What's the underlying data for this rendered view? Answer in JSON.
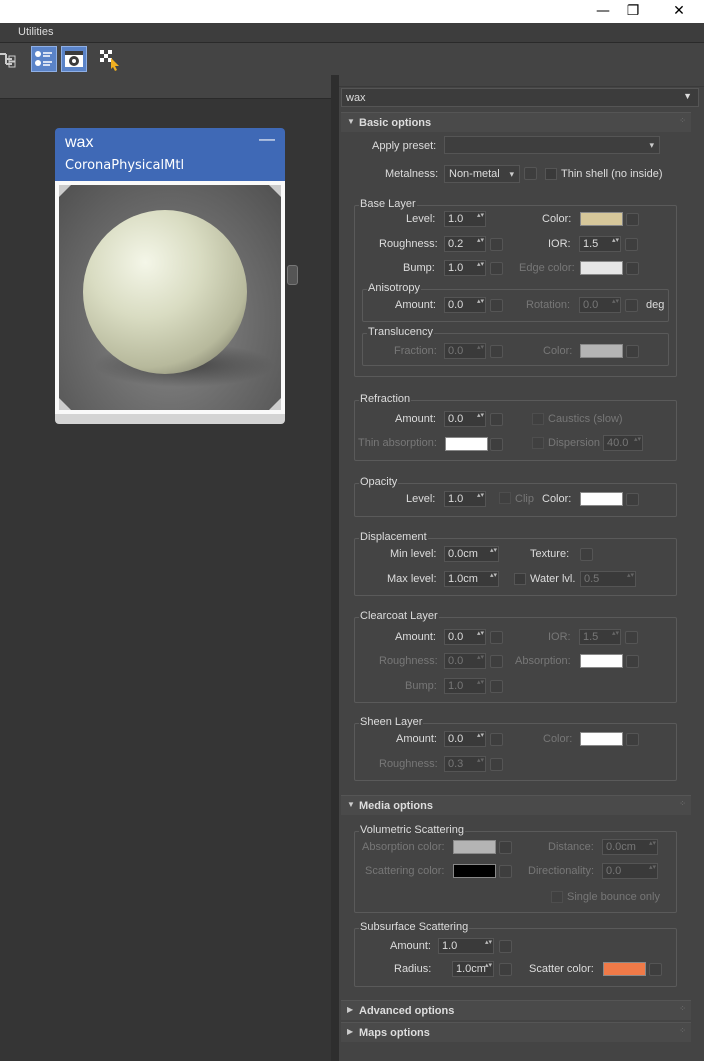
{
  "window": {
    "minimize": "—",
    "maximize": "❐",
    "close": "✕"
  },
  "menu": {
    "utilities": "Utilities"
  },
  "node": {
    "name": "wax",
    "class": "CoronaPhysicalMtl",
    "collapse": "—"
  },
  "material_name": "wax",
  "rollouts": {
    "basic": "Basic options",
    "media": "Media options",
    "advanced": "Advanced options",
    "maps": "Maps options"
  },
  "basic": {
    "apply_preset_label": "Apply preset:",
    "apply_preset_value": "",
    "metalness_label": "Metalness:",
    "metalness_value": "Non-metal",
    "thin_shell_label": "Thin shell (no inside)",
    "base_layer": {
      "title": "Base Layer",
      "level_label": "Level:",
      "level": "1.0",
      "color_label": "Color:",
      "roughness_label": "Roughness:",
      "roughness": "0.2",
      "ior_label": "IOR:",
      "ior": "1.5",
      "bump_label": "Bump:",
      "bump": "1.0",
      "edge_color_label": "Edge color:",
      "anisotropy": {
        "title": "Anisotropy",
        "amount_label": "Amount:",
        "amount": "0.0",
        "rotation_label": "Rotation:",
        "rotation": "0.0",
        "unit": "deg"
      },
      "translucency": {
        "title": "Translucency",
        "fraction_label": "Fraction:",
        "fraction": "0.0",
        "color_label": "Color:"
      }
    },
    "refraction": {
      "title": "Refraction",
      "amount_label": "Amount:",
      "amount": "0.0",
      "caustics_label": "Caustics (slow)",
      "thin_absorption_label": "Thin absorption:",
      "dispersion_label": "Dispersion",
      "dispersion": "40.0"
    },
    "opacity": {
      "title": "Opacity",
      "level_label": "Level:",
      "level": "1.0",
      "clip_label": "Clip",
      "color_label": "Color:"
    },
    "displacement": {
      "title": "Displacement",
      "min_label": "Min level:",
      "min": "0.0cm",
      "texture_label": "Texture:",
      "max_label": "Max level:",
      "max": "1.0cm",
      "water_label": "Water lvl.",
      "water": "0.5"
    },
    "clearcoat": {
      "title": "Clearcoat Layer",
      "amount_label": "Amount:",
      "amount": "0.0",
      "ior_label": "IOR:",
      "ior": "1.5",
      "roughness_label": "Roughness:",
      "roughness": "0.0",
      "absorption_label": "Absorption:",
      "bump_label": "Bump:",
      "bump": "1.0"
    },
    "sheen": {
      "title": "Sheen Layer",
      "amount_label": "Amount:",
      "amount": "0.0",
      "color_label": "Color:",
      "roughness_label": "Roughness:",
      "roughness": "0.3"
    }
  },
  "media": {
    "volumetric": {
      "title": "Volumetric Scattering",
      "absorption_label": "Absorption color:",
      "distance_label": "Distance:",
      "distance": "0.0cm",
      "scattering_label": "Scattering color:",
      "directionality_label": "Directionality:",
      "directionality": "0.0",
      "single_bounce_label": "Single bounce only"
    },
    "subsurface": {
      "title": "Subsurface Scattering",
      "amount_label": "Amount:",
      "amount": "1.0",
      "radius_label": "Radius:",
      "radius": "1.0cm",
      "scatter_color_label": "Scatter color:"
    }
  },
  "colors": {
    "base_color": "#d6c79a",
    "edge_color": "#e6e6e6",
    "translucency_color": "#b4b4b4",
    "thin_absorption_color": "#ffffff",
    "opacity_color": "#ffffff",
    "clearcoat_absorption_color": "#ffffff",
    "sheen_color": "#ffffff",
    "vol_absorption_color": "#b4b4b4",
    "vol_scattering_color": "#000000",
    "scatter_color": "#f07a48",
    "node_header": "#3f69b6"
  }
}
